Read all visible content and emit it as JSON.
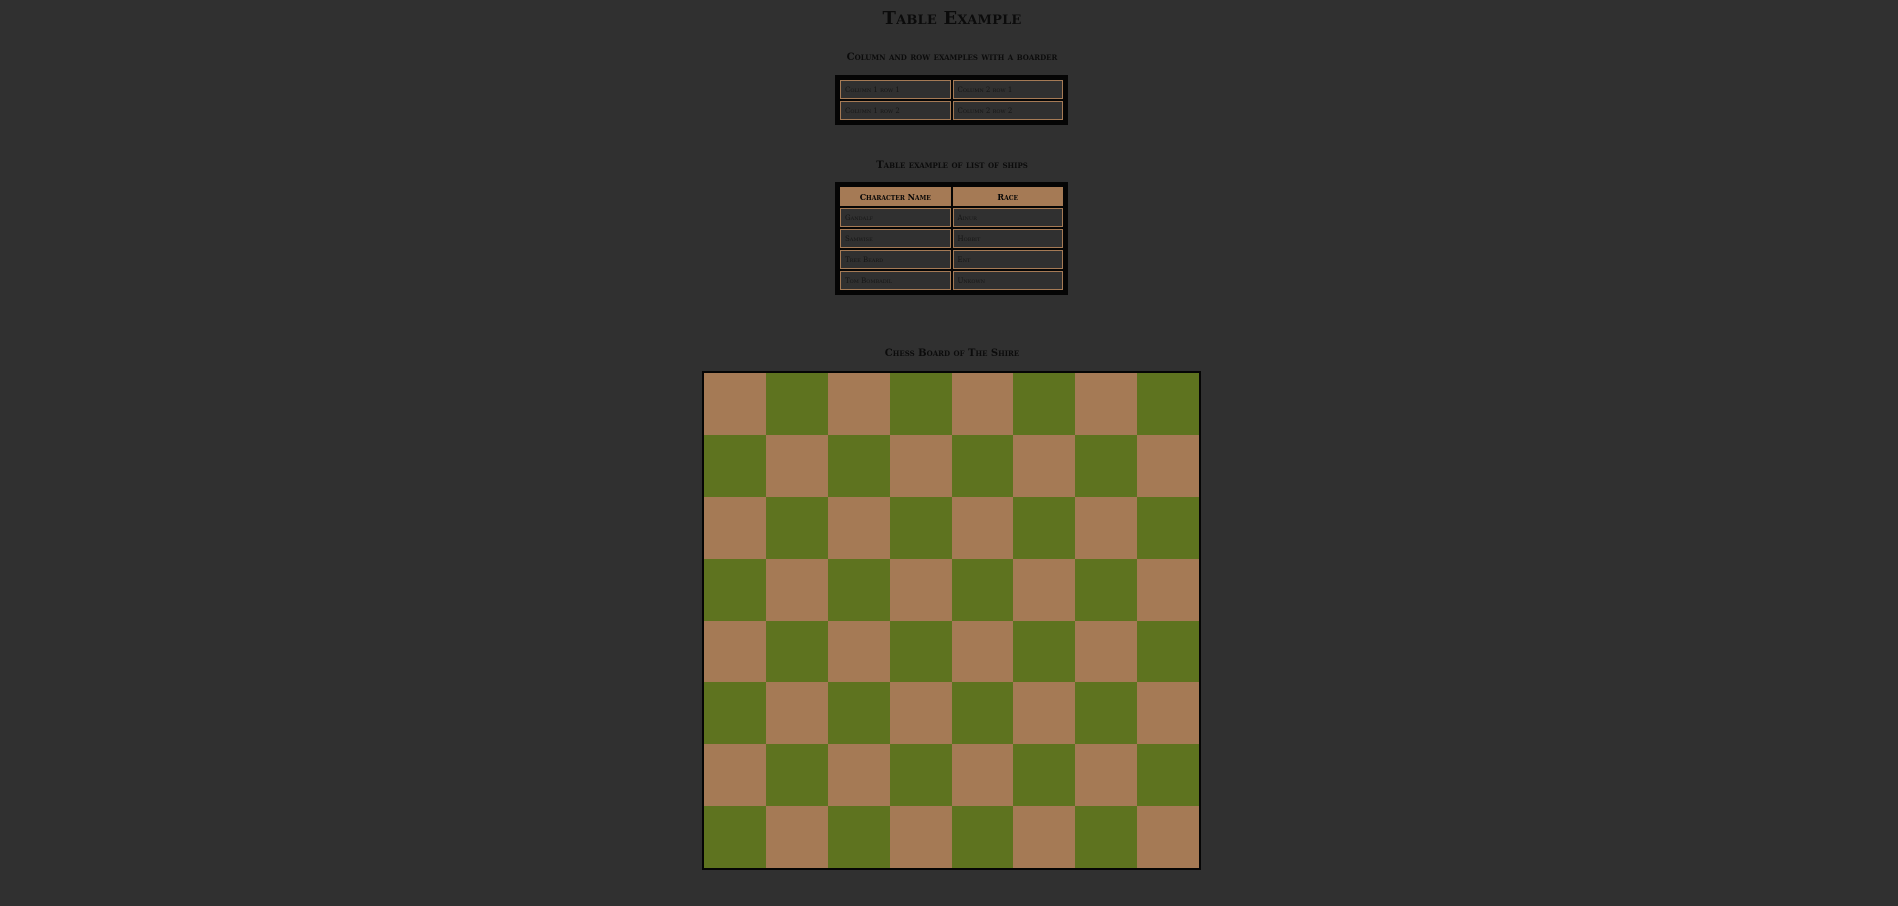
{
  "page": {
    "title": "Table Example"
  },
  "colors": {
    "background": "#303030",
    "accent": "#a57a55",
    "green": "#5e731f",
    "border": "#050505"
  },
  "table1": {
    "heading": "Column and row examples with a boarder",
    "rows": [
      [
        "Column 1 row 1",
        "Column 2 row 1"
      ],
      [
        "Column 1 row 2",
        "Column 2 row 2"
      ]
    ]
  },
  "table2": {
    "heading": "Table example of list of ships",
    "headers": [
      "Character Name",
      "Race"
    ],
    "rows": [
      [
        "Gandalf",
        "Ainur"
      ],
      [
        "Samwise",
        "Hobbit"
      ],
      [
        "Tree Beard",
        "Ent"
      ],
      [
        "Tom Bombadil",
        "Unkown"
      ]
    ]
  },
  "chess": {
    "heading": "Chess Board of The Shire",
    "size": 8,
    "light": "#a57a55",
    "dark": "#5e731f"
  }
}
